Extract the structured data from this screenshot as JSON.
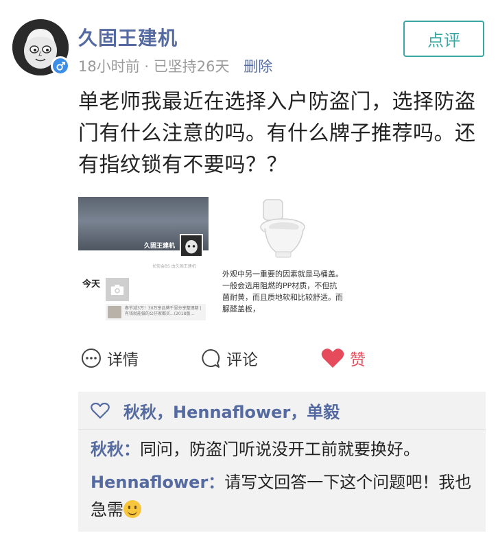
{
  "post": {
    "author": "久固王建机",
    "time": "18小时前",
    "separator": "·",
    "streak": "已坚持26天",
    "delete_label": "删除",
    "review_label": "点评",
    "text": "单老师我最近在选择入户防盗门，选择防盗门有什么注意的吗。有什么牌子推荐吗。还有指纹锁有不要吗？？",
    "avatar_icon": "cartoon-face-avatar",
    "gender_icon": "male-gender-icon"
  },
  "thumbnails": [
    {
      "name": "久固王建机",
      "subtitle": "长街会BS 由久固王建机",
      "today": "今天",
      "row_text": "春节减3万！30万享品牌千里分享整理期 | 有钱就能做的公仔家都买...(2018版..."
    },
    {
      "text": "外观中另一重要的因素就是马桶盖。一般会选用阻燃的PP材质，不但抗菌耐黄，而且质地软和比较舒适。而脲醛盖板，"
    }
  ],
  "actions": {
    "detail_label": "详情",
    "comment_label": "评论",
    "like_label": "赞",
    "like_color": "#e54b5b"
  },
  "feedback": {
    "likes": "秋秋，Hennaflower，单毅",
    "comments": [
      {
        "author": "秋秋",
        "colon": "：",
        "text": "同问，防盗门听说没开工前就要换好。"
      },
      {
        "author": "Hennaflower",
        "colon": "：",
        "text": "请写文回答一下这个问题吧！我也急需"
      }
    ]
  },
  "colors": {
    "link_blue": "#546aa0",
    "teal": "#3aa7a3",
    "meta_gray": "#9a9a9a"
  }
}
